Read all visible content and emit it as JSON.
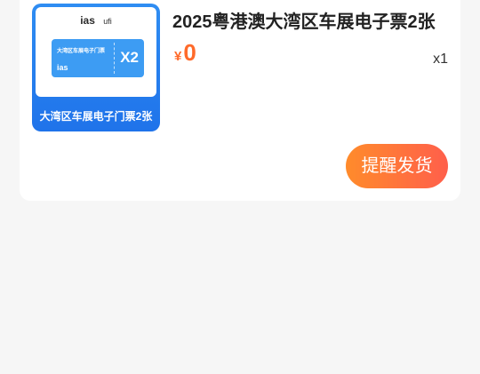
{
  "order_item": {
    "title": "2025粤港澳大湾区车展电子票2张",
    "price_symbol": "¥",
    "price_amount": "0",
    "quantity": "x1",
    "thumbnail": {
      "logo_text": "ias",
      "logo_secondary": "ufi",
      "ticket_title": "大湾区车展电子门票",
      "ticket_logo": "ias",
      "ticket_count": "X2",
      "caption": "大湾区车展电子门票2张"
    },
    "action_button_label": "提醒发货"
  },
  "colors": {
    "accent": "#ff6a2a",
    "button_gradient_start": "#ff8b2b",
    "button_gradient_end": "#ff5f4b",
    "thumb_blue": "#2f8df2"
  }
}
